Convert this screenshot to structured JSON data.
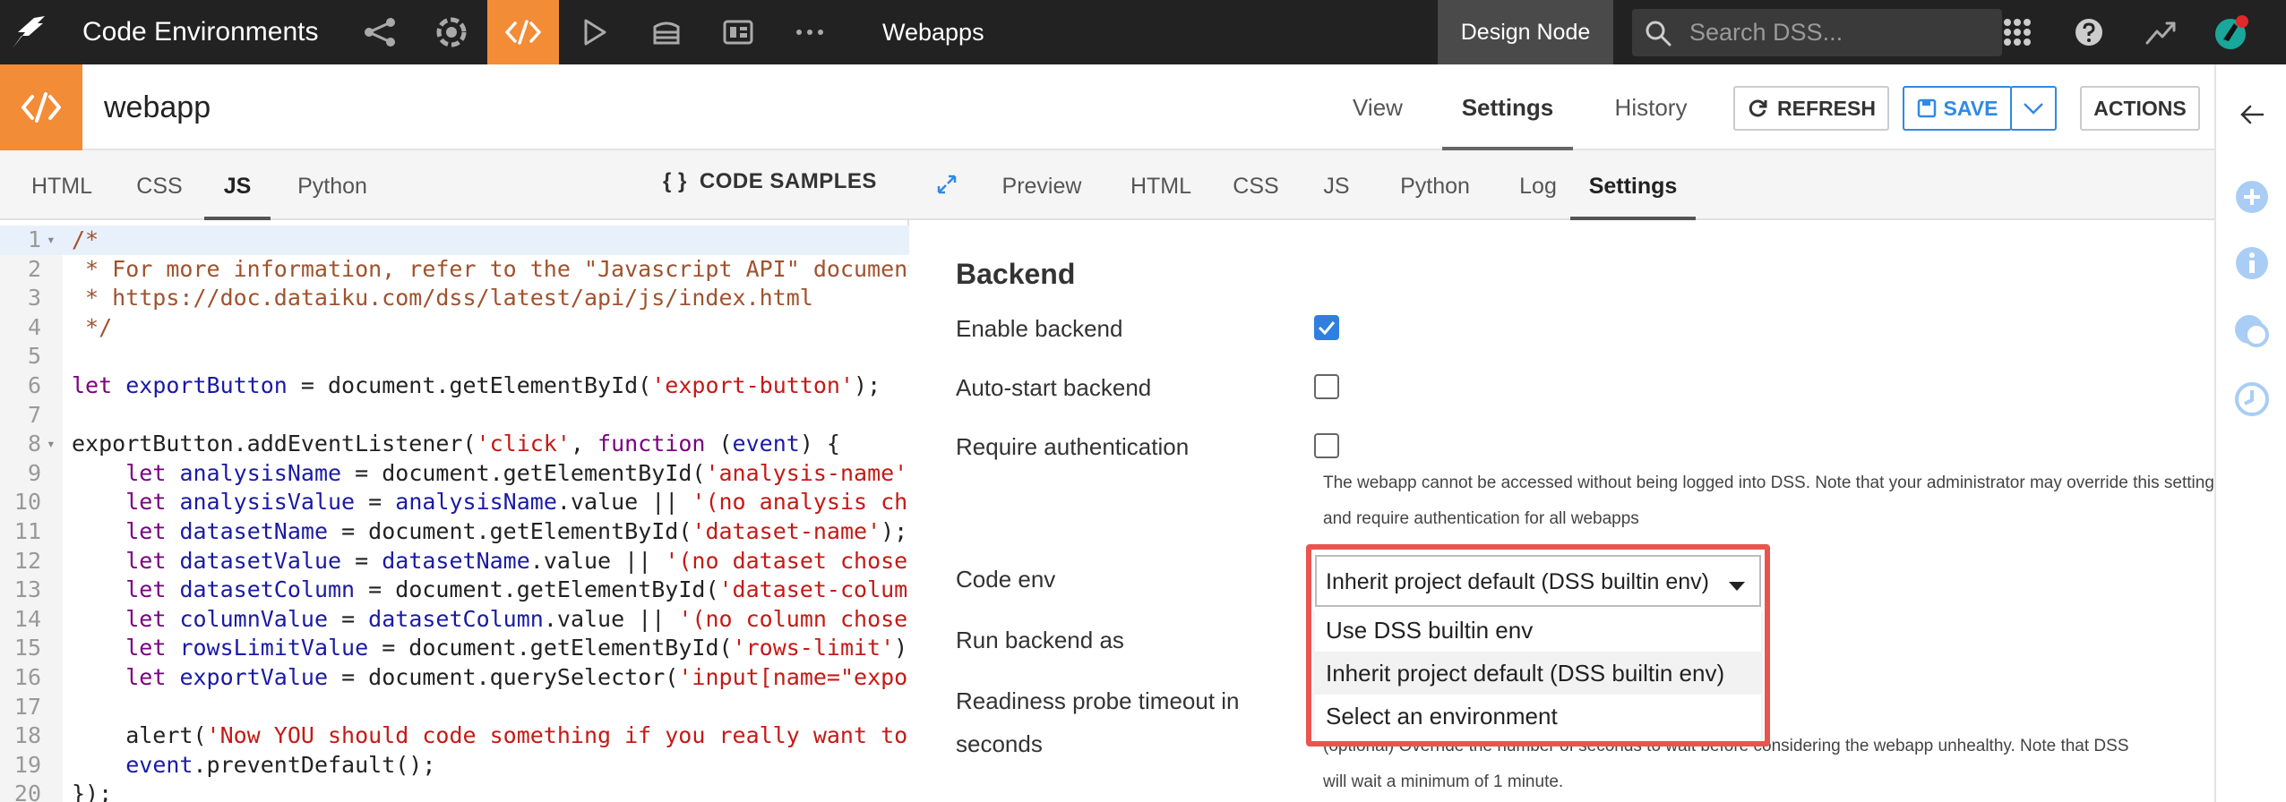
{
  "topbar": {
    "app_title": "Code Environments",
    "nav_icons": [
      "flow-share-icon",
      "dataset-gear-icon",
      "code-icon",
      "play-icon",
      "stack-icon",
      "dashboard-icon",
      "more-icon"
    ],
    "section_label": "Webapps",
    "design_node": "Design Node",
    "search_placeholder": "Search DSS...",
    "accent_color": "#f28c37"
  },
  "object": {
    "title": "webapp",
    "tabs": [
      "View",
      "Settings",
      "History"
    ],
    "active_tab": "Settings",
    "refresh_label": "REFRESH",
    "save_label": "SAVE",
    "actions_label": "ACTIONS"
  },
  "editor": {
    "tabs": [
      "HTML",
      "CSS",
      "JS",
      "Python"
    ],
    "active_tab": "JS",
    "code_samples_label": "CODE SAMPLES",
    "lines": [
      {
        "n": "1",
        "fold": true,
        "parts": [
          [
            "cm",
            "/*"
          ]
        ]
      },
      {
        "n": "2",
        "parts": [
          [
            "cm",
            " * For more information, refer to the \"Javascript API\" documentation:"
          ]
        ]
      },
      {
        "n": "3",
        "parts": [
          [
            "cm",
            " * https://doc.dataiku.com/dss/latest/api/js/index.html"
          ]
        ]
      },
      {
        "n": "4",
        "parts": [
          [
            "cm",
            " */"
          ]
        ]
      },
      {
        "n": "5",
        "parts": []
      },
      {
        "n": "6",
        "parts": [
          [
            "kw",
            "let "
          ],
          [
            "var",
            "exportButton"
          ],
          [
            "pl",
            " = document.getElementById("
          ],
          [
            "str",
            "'export-button'"
          ],
          [
            "pl",
            ");"
          ]
        ]
      },
      {
        "n": "7",
        "parts": []
      },
      {
        "n": "8",
        "fold": true,
        "parts": [
          [
            "pl",
            "exportButton.addEventListener("
          ],
          [
            "str",
            "'click'"
          ],
          [
            "pl",
            ", "
          ],
          [
            "kw",
            "function"
          ],
          [
            "pl",
            " ("
          ],
          [
            "var",
            "event"
          ],
          [
            "pl",
            ") {"
          ]
        ]
      },
      {
        "n": "9",
        "parts": [
          [
            "pl",
            "    "
          ],
          [
            "kw",
            "let "
          ],
          [
            "var",
            "analysisName"
          ],
          [
            "pl",
            " = document.getElementById("
          ],
          [
            "str",
            "'analysis-name'"
          ],
          [
            "pl",
            ");"
          ]
        ]
      },
      {
        "n": "10",
        "parts": [
          [
            "pl",
            "    "
          ],
          [
            "kw",
            "let "
          ],
          [
            "var",
            "analysisValue"
          ],
          [
            "pl",
            " = "
          ],
          [
            "var",
            "analysisName"
          ],
          [
            "pl",
            ".value || "
          ],
          [
            "str",
            "'(no analysis chosen)'"
          ],
          [
            "pl",
            ";"
          ]
        ]
      },
      {
        "n": "11",
        "parts": [
          [
            "pl",
            "    "
          ],
          [
            "kw",
            "let "
          ],
          [
            "var",
            "datasetName"
          ],
          [
            "pl",
            " = document.getElementById("
          ],
          [
            "str",
            "'dataset-name'"
          ],
          [
            "pl",
            ");"
          ]
        ]
      },
      {
        "n": "12",
        "parts": [
          [
            "pl",
            "    "
          ],
          [
            "kw",
            "let "
          ],
          [
            "var",
            "datasetValue"
          ],
          [
            "pl",
            " = "
          ],
          [
            "var",
            "datasetName"
          ],
          [
            "pl",
            ".value || "
          ],
          [
            "str",
            "'(no dataset chosen)'"
          ],
          [
            "pl",
            ";"
          ]
        ]
      },
      {
        "n": "13",
        "parts": [
          [
            "pl",
            "    "
          ],
          [
            "kw",
            "let "
          ],
          [
            "var",
            "datasetColumn"
          ],
          [
            "pl",
            " = document.getElementById("
          ],
          [
            "str",
            "'dataset-column'"
          ],
          [
            "pl",
            ");"
          ]
        ]
      },
      {
        "n": "14",
        "parts": [
          [
            "pl",
            "    "
          ],
          [
            "kw",
            "let "
          ],
          [
            "var",
            "columnValue"
          ],
          [
            "pl",
            " = "
          ],
          [
            "var",
            "datasetColumn"
          ],
          [
            "pl",
            ".value || "
          ],
          [
            "str",
            "'(no column chosen)'"
          ],
          [
            "pl",
            ";"
          ]
        ]
      },
      {
        "n": "15",
        "parts": [
          [
            "pl",
            "    "
          ],
          [
            "kw",
            "let "
          ],
          [
            "var",
            "rowsLimitValue"
          ],
          [
            "pl",
            " = document.getElementById("
          ],
          [
            "str",
            "'rows-limit'"
          ],
          [
            "pl",
            ").value;"
          ]
        ]
      },
      {
        "n": "16",
        "parts": [
          [
            "pl",
            "    "
          ],
          [
            "kw",
            "let "
          ],
          [
            "var",
            "exportValue"
          ],
          [
            "pl",
            " = document.querySelector("
          ],
          [
            "str",
            "'input[name=\"export\"]'"
          ],
          [
            "pl",
            ");"
          ]
        ]
      },
      {
        "n": "17",
        "parts": []
      },
      {
        "n": "18",
        "parts": [
          [
            "pl",
            "    alert("
          ],
          [
            "str",
            "'Now YOU should code something if you really want to export data!'"
          ],
          [
            "pl",
            ");"
          ]
        ]
      },
      {
        "n": "19",
        "parts": [
          [
            "pl",
            "    "
          ],
          [
            "var",
            "event"
          ],
          [
            "pl",
            ".preventDefault();"
          ]
        ]
      },
      {
        "n": "20",
        "parts": [
          [
            "pl",
            "});"
          ]
        ]
      }
    ]
  },
  "preview": {
    "tabs": [
      "Preview",
      "HTML",
      "CSS",
      "JS",
      "Python",
      "Log",
      "Settings"
    ],
    "active_tab": "Settings"
  },
  "settings": {
    "section_title": "Backend",
    "enable_backend_label": "Enable backend",
    "enable_backend_checked": true,
    "auto_start_label": "Auto-start backend",
    "auto_start_checked": false,
    "require_auth_label": "Require authentication",
    "require_auth_checked": false,
    "auth_help_line1": "The webapp cannot be accessed without being logged into DSS. Note that your administrator may override this setting",
    "auth_help_line2": "and require authentication for all webapps",
    "code_env_label": "Code env",
    "code_env_value": "Inherit project default (DSS builtin env)",
    "code_env_options": [
      "Use DSS builtin env",
      "Inherit project default (DSS builtin env)",
      "Select an environment"
    ],
    "run_backend_as_label": "Run backend as",
    "readiness_label_line1": "Readiness probe timeout in",
    "readiness_label_line2": "seconds",
    "readiness_help_line1": "(optional) Override the number of seconds to wait before considering the webapp unhealthy. Note that DSS",
    "readiness_help_line2": "will wait a minimum of 1 minute."
  }
}
